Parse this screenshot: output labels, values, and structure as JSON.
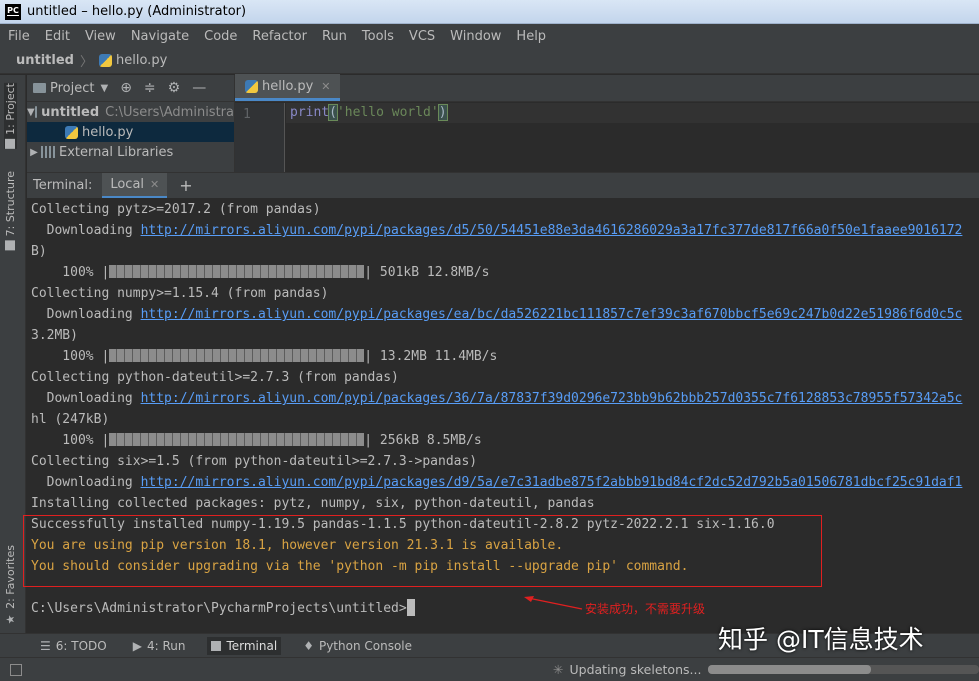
{
  "window": {
    "title": "untitled – hello.py (Administrator)",
    "logo_text": "PC"
  },
  "menu": [
    "File",
    "Edit",
    "View",
    "Navigate",
    "Code",
    "Refactor",
    "Run",
    "Tools",
    "VCS",
    "Window",
    "Help"
  ],
  "breadcrumb": {
    "root": "untitled",
    "file": "hello.py"
  },
  "left_stripe": {
    "project_tab": "1: Project",
    "structure_tab": "7: Structure",
    "favorites_tab": "2: Favorites"
  },
  "project_panel": {
    "title": "Project",
    "root_name": "untitled",
    "root_path": "C:\\Users\\Administra",
    "file": "hello.py",
    "libraries": "External Libraries"
  },
  "editor": {
    "tab_label": "hello.py",
    "line_number": "1",
    "code": {
      "fn": "print",
      "open": "(",
      "arg": "'hello world'",
      "close": ")"
    }
  },
  "terminal": {
    "label": "Terminal:",
    "tab": "Local",
    "lines": [
      {
        "text": "Collecting pytz>=2017.2 (from pandas)"
      },
      {
        "prefix": "  Downloading ",
        "url": "http://mirrors.aliyun.com/pypi/packages/d5/50/54451e88e3da4616286029a3a17fc377de817f66a0f50e1faaee9016172"
      },
      {
        "text": "B)"
      },
      {
        "pct": "    100% |",
        "suffix": "| 501kB 12.8MB/s",
        "progress": 1.0
      },
      {
        "text": "Collecting numpy>=1.15.4 (from pandas)"
      },
      {
        "prefix": "  Downloading ",
        "url": "http://mirrors.aliyun.com/pypi/packages/ea/bc/da526221bc111857c7ef39c3af670bbcf5e69c247b0d22e51986f6d0c5c"
      },
      {
        "text": "3.2MB)"
      },
      {
        "pct": "    100% |",
        "suffix": "| 13.2MB 11.4MB/s",
        "progress": 1.0
      },
      {
        "text": "Collecting python-dateutil>=2.7.3 (from pandas)"
      },
      {
        "prefix": "  Downloading ",
        "url": "http://mirrors.aliyun.com/pypi/packages/36/7a/87837f39d0296e723bb9b62bbb257d0355c7f6128853c78955f57342a5c"
      },
      {
        "text": "hl (247kB)"
      },
      {
        "pct": "    100% |",
        "suffix": "| 256kB 8.5MB/s",
        "progress": 1.0
      },
      {
        "text": "Collecting six>=1.5 (from python-dateutil>=2.7.3->pandas)"
      },
      {
        "prefix": "  Downloading ",
        "url": "http://mirrors.aliyun.com/pypi/packages/d9/5a/e7c31adbe875f2abbb91bd84cf2dc52d792b5a01506781dbcf25c91daf1"
      },
      {
        "text": "Installing collected packages: pytz, numpy, six, python-dateutil, pandas"
      },
      {
        "text": "Successfully installed numpy-1.19.5 pandas-1.1.5 python-dateutil-2.8.2 pytz-2022.2.1 six-1.16.0"
      },
      {
        "text": "You are using pip version 18.1, however version 21.3.1 is available.",
        "warn": true
      },
      {
        "text": "You should consider upgrading via the 'python -m pip install --upgrade pip' command.",
        "warn": true
      },
      {
        "text": ""
      },
      {
        "text": "C:\\Users\\Administrator\\PycharmProjects\\untitled>",
        "prompt": true
      }
    ]
  },
  "annotation": "安装成功，不需要升级",
  "bottom_tools": [
    "6: TODO",
    "4: Run",
    "Terminal",
    "Python Console"
  ],
  "status": {
    "text": "Updating skeletons...",
    "progress": 0.6
  },
  "watermark": "知乎 @IT信息技术",
  "colors": {
    "accent": "#4a88c7",
    "link": "#589df6",
    "warning": "#d9a343",
    "annotation": "#e02020"
  }
}
